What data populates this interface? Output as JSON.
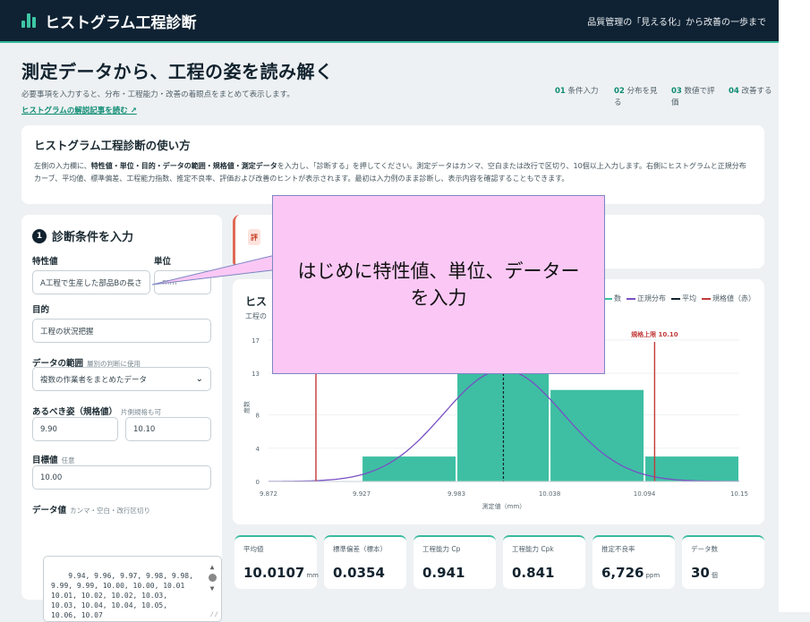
{
  "app": {
    "title": "ヒストグラム工程診断",
    "tagline": "品質管理の「見える化」から改善の一歩まで"
  },
  "hero": {
    "title": "測定データから、工程の姿を読み解く",
    "subtitle": "必要事項を入力すると、分布・工程能力・改善の着眼点をまとめて表示します。",
    "link": "ヒストグラムの解説記事を読む ↗",
    "steps": [
      {
        "num": "01",
        "label": "条件入力"
      },
      {
        "num": "02",
        "label": "分布を見る"
      },
      {
        "num": "03",
        "label": "数値で評価"
      },
      {
        "num": "04",
        "label": "改善する"
      }
    ]
  },
  "howto": {
    "title": "ヒストグラム工程診断の使い方",
    "p1a": "左側の入力欄に、",
    "p1b": "特性値・単位・目的・データの範囲・規格値・測定データ",
    "p1c": "を入力し、「診断する」を押してください。測定データはカンマ、空白または改行で区切り、10個以上入力します。右側にヒストグラムと正規分布カーブ、平均値、標準偏差、工程能力指数、推定不良率、評価および改善のヒントが表示されます。最初は入力例のまま診断し、表示内容を確認することもできます。"
  },
  "form": {
    "step": "1",
    "title": "診断条件を入力",
    "characteristic_label": "特性値",
    "characteristic_value": "A工程で生産した部品Bの長さ",
    "unit_label": "単位",
    "unit_value": "mm",
    "purpose_label": "目的",
    "purpose_value": "工程の状況把握",
    "range_label": "データの範囲",
    "range_hint": "層別の判断に使用",
    "range_value": "複数の作業者をまとめたデータ",
    "spec_label": "あるべき姿（規格値）",
    "spec_hint": "片側規格も可",
    "spec_lower": "9.90",
    "spec_upper": "10.10",
    "target_label": "目標値",
    "target_hint": "任意",
    "target_value": "10.00",
    "data_label": "データ値",
    "data_hint": "カンマ・空白・改行区切り",
    "data_value": "9.94, 9.96, 9.97, 9.98, 9.98,\n9.99, 9.99, 10.00, 10.00, 10.01\n10.01, 10.02, 10.02, 10.03,\n10.03, 10.04, 10.04, 10.05,\n10.06, 10.07"
  },
  "status": {
    "badge": "評"
  },
  "chart": {
    "title": "ヒス",
    "subtitle": "工程の",
    "legend": [
      {
        "label": "数",
        "color": "#3ebfa3"
      },
      {
        "label": "正規分布",
        "color": "#7a4fc4"
      },
      {
        "label": "平均",
        "color": "#12232f"
      },
      {
        "label": "規格値（赤）",
        "color": "#c33a3a"
      }
    ]
  },
  "chart_data": {
    "type": "bar",
    "xlabel": "測定値（mm）",
    "ylabel": "度数",
    "x_ticks": [
      "9.872",
      "9.927",
      "9.983",
      "10.038",
      "10.094",
      "10.15"
    ],
    "y_ticks": [
      0,
      4,
      8,
      13,
      17
    ],
    "bins": [
      {
        "from": 9.872,
        "to": 9.927,
        "count": 0
      },
      {
        "from": 9.927,
        "to": 9.983,
        "count": 3
      },
      {
        "from": 9.983,
        "to": 10.038,
        "count": 13
      },
      {
        "from": 10.038,
        "to": 10.094,
        "count": 11
      },
      {
        "from": 10.094,
        "to": 10.15,
        "count": 3
      }
    ],
    "xlim": [
      9.872,
      10.15
    ],
    "ylim": [
      0,
      20
    ],
    "mean": 10.0107,
    "sd": 0.0354,
    "spec_lower": 9.9,
    "spec_upper": 10.1,
    "spec_upper_label": "規格上限 10.10"
  },
  "metrics": [
    {
      "label": "平均値",
      "value": "10.0107",
      "unit": "mm"
    },
    {
      "label": "標準偏差（標本）",
      "value": "0.0354",
      "unit": ""
    },
    {
      "label": "工程能力 Cp",
      "value": "0.941",
      "unit": ""
    },
    {
      "label": "工程能力 Cpk",
      "value": "0.841",
      "unit": ""
    },
    {
      "label": "推定不良率",
      "value": "6,726",
      "unit": "ppm"
    },
    {
      "label": "データ数",
      "value": "30",
      "unit": "個"
    }
  ],
  "callout": {
    "text": "はじめに特性値、単位、データーを入力"
  }
}
